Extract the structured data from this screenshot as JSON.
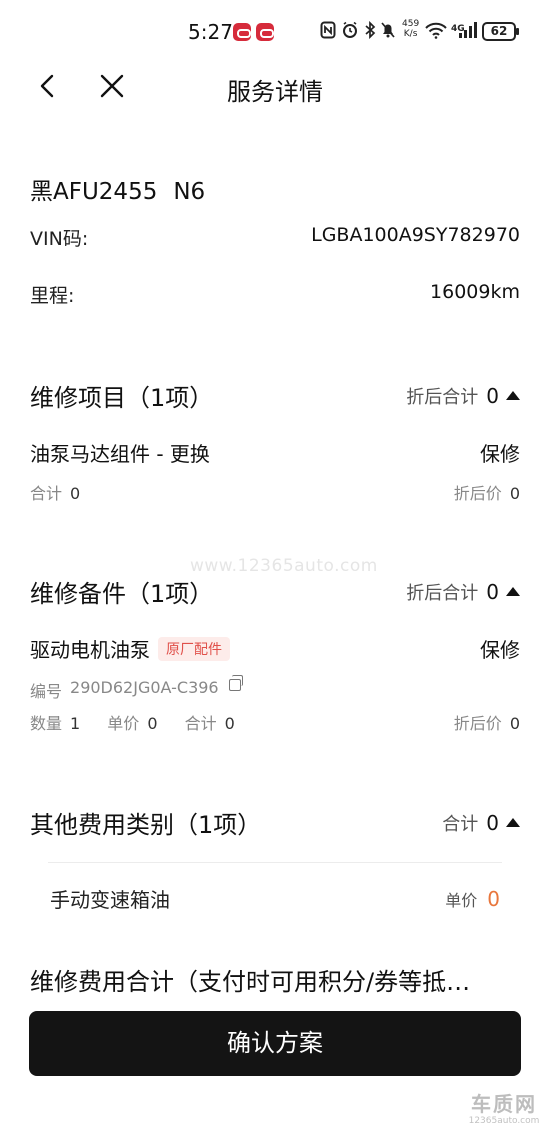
{
  "status_bar": {
    "time": "5:27",
    "net_speed_value": "459",
    "net_speed_unit": "K/s",
    "network": "4G",
    "battery": "62"
  },
  "header": {
    "title": "服务详情"
  },
  "vehicle": {
    "plate": "黑AFU2455",
    "model": "N6",
    "vin_label": "VIN码:",
    "vin_value": "LGBA100A9SY782970",
    "mileage_label": "里程:",
    "mileage_value": "16009km"
  },
  "repair_items": {
    "title": "维修项目（1项）",
    "total_label": "折后合计",
    "total_value": "0",
    "items": [
      {
        "name": "油泵马达组件 - 更换",
        "type": "保修",
        "subtotal_label": "合计",
        "subtotal_value": "0",
        "discount_label": "折后价",
        "discount_value": "0"
      }
    ]
  },
  "repair_parts": {
    "title": "维修备件（1项）",
    "total_label": "折后合计",
    "total_value": "0",
    "items": [
      {
        "name": "驱动电机油泵",
        "tag": "原厂配件",
        "type": "保修",
        "code_label": "编号",
        "code_value": "290D62JG0A-C396",
        "qty_label": "数量",
        "qty_value": "1",
        "unit_price_label": "单价",
        "unit_price_value": "0",
        "subtotal_label": "合计",
        "subtotal_value": "0",
        "discount_label": "折后价",
        "discount_value": "0"
      }
    ]
  },
  "other_fees": {
    "title": "其他费用类别（1项）",
    "total_label": "合计",
    "total_value": "0",
    "items": [
      {
        "name": "手动变速箱油",
        "price_label": "单价",
        "price_value": "0"
      }
    ]
  },
  "fee_summary": {
    "title": "维修费用合计（支付时可用积分/券等抵…"
  },
  "confirm_button": {
    "label": "确认方案"
  },
  "watermark": {
    "text": "www.12365auto.com"
  },
  "corner_logo": {
    "title": "车质网",
    "url": "12365auto.com"
  },
  "colors": {
    "button_bg": "#141414",
    "tag_text": "#e0504a",
    "tag_bg": "#fdecea",
    "price_accent": "#e8763c"
  }
}
